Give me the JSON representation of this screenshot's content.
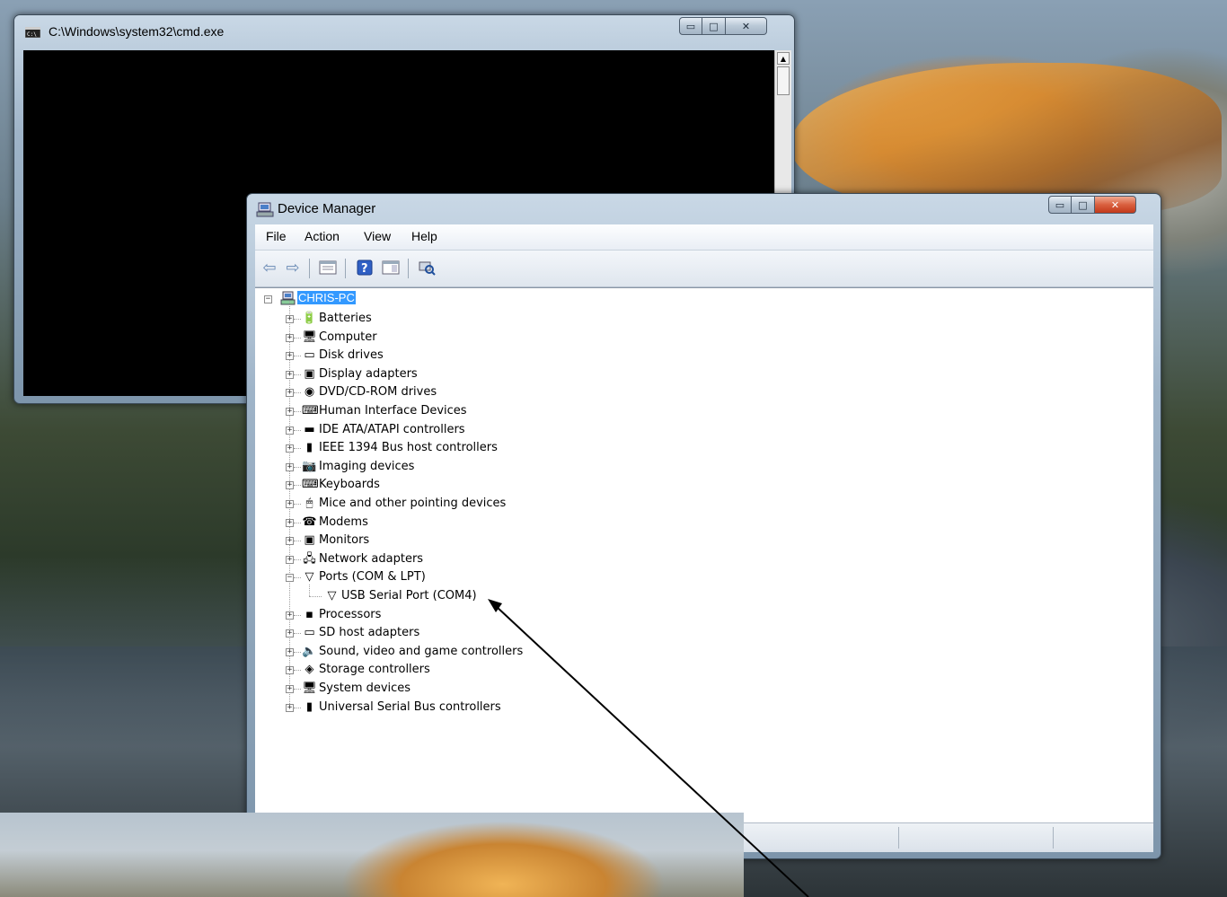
{
  "cmd_window": {
    "title": "C:\\Windows\\system32\\cmd.exe",
    "minimize_glyph": "▭",
    "maximize_glyph": "□",
    "close_glyph": "✕",
    "scroll_up_glyph": "▲"
  },
  "device_manager": {
    "title": "Device Manager",
    "minimize_glyph": "▭",
    "maximize_glyph": "□",
    "close_glyph": "✕",
    "menu": [
      "File",
      "Action",
      "View",
      "Help"
    ],
    "toolbar": {
      "back_glyph": "⇦",
      "forward_glyph": "⇨",
      "help_glyph": "?"
    },
    "root": "CHRIS-PC",
    "categories": [
      {
        "label": "Batteries",
        "icon": "battery-icon",
        "glyph": "🔋",
        "expanded": false
      },
      {
        "label": "Computer",
        "icon": "computer-icon",
        "glyph": "🖥",
        "expanded": false
      },
      {
        "label": "Disk drives",
        "icon": "disk-drive-icon",
        "glyph": "▭",
        "expanded": false
      },
      {
        "label": "Display adapters",
        "icon": "display-adapter-icon",
        "glyph": "▣",
        "expanded": false
      },
      {
        "label": "DVD/CD-ROM drives",
        "icon": "dvd-drive-icon",
        "glyph": "◉",
        "expanded": false
      },
      {
        "label": "Human Interface Devices",
        "icon": "hid-icon",
        "glyph": "⌨",
        "expanded": false
      },
      {
        "label": "IDE ATA/ATAPI controllers",
        "icon": "ide-controller-icon",
        "glyph": "▬",
        "expanded": false
      },
      {
        "label": "IEEE 1394 Bus host controllers",
        "icon": "ieee1394-icon",
        "glyph": "▮",
        "expanded": false
      },
      {
        "label": "Imaging devices",
        "icon": "camera-icon",
        "glyph": "📷",
        "expanded": false
      },
      {
        "label": "Keyboards",
        "icon": "keyboard-icon",
        "glyph": "⌨",
        "expanded": false
      },
      {
        "label": "Mice and other pointing devices",
        "icon": "mouse-icon",
        "glyph": "🖱",
        "expanded": false
      },
      {
        "label": "Modems",
        "icon": "modem-icon",
        "glyph": "☎",
        "expanded": false
      },
      {
        "label": "Monitors",
        "icon": "monitor-icon",
        "glyph": "▣",
        "expanded": false
      },
      {
        "label": "Network adapters",
        "icon": "network-adapter-icon",
        "glyph": "🖧",
        "expanded": false
      },
      {
        "label": "Ports (COM & LPT)",
        "icon": "port-icon",
        "glyph": "▽",
        "expanded": true
      },
      {
        "label": "Processors",
        "icon": "processor-icon",
        "glyph": "▪",
        "expanded": false
      },
      {
        "label": "SD host adapters",
        "icon": "sd-adapter-icon",
        "glyph": "▭",
        "expanded": false
      },
      {
        "label": "Sound, video and game controllers",
        "icon": "speaker-icon",
        "glyph": "🔈",
        "expanded": false
      },
      {
        "label": "Storage controllers",
        "icon": "storage-controller-icon",
        "glyph": "◈",
        "expanded": false
      },
      {
        "label": "System devices",
        "icon": "system-devices-icon",
        "glyph": "🖥",
        "expanded": false
      },
      {
        "label": "Universal Serial Bus controllers",
        "icon": "usb-icon",
        "glyph": "▮",
        "expanded": false
      }
    ],
    "ports_children": [
      {
        "label": "USB Serial Port (COM4)",
        "icon": "port-icon",
        "glyph": "▽"
      }
    ],
    "expand_glyph": "+",
    "collapse_glyph": "−"
  },
  "colors": {
    "selection": "#3399ff",
    "console": "#000000",
    "arrow": "#000000"
  }
}
